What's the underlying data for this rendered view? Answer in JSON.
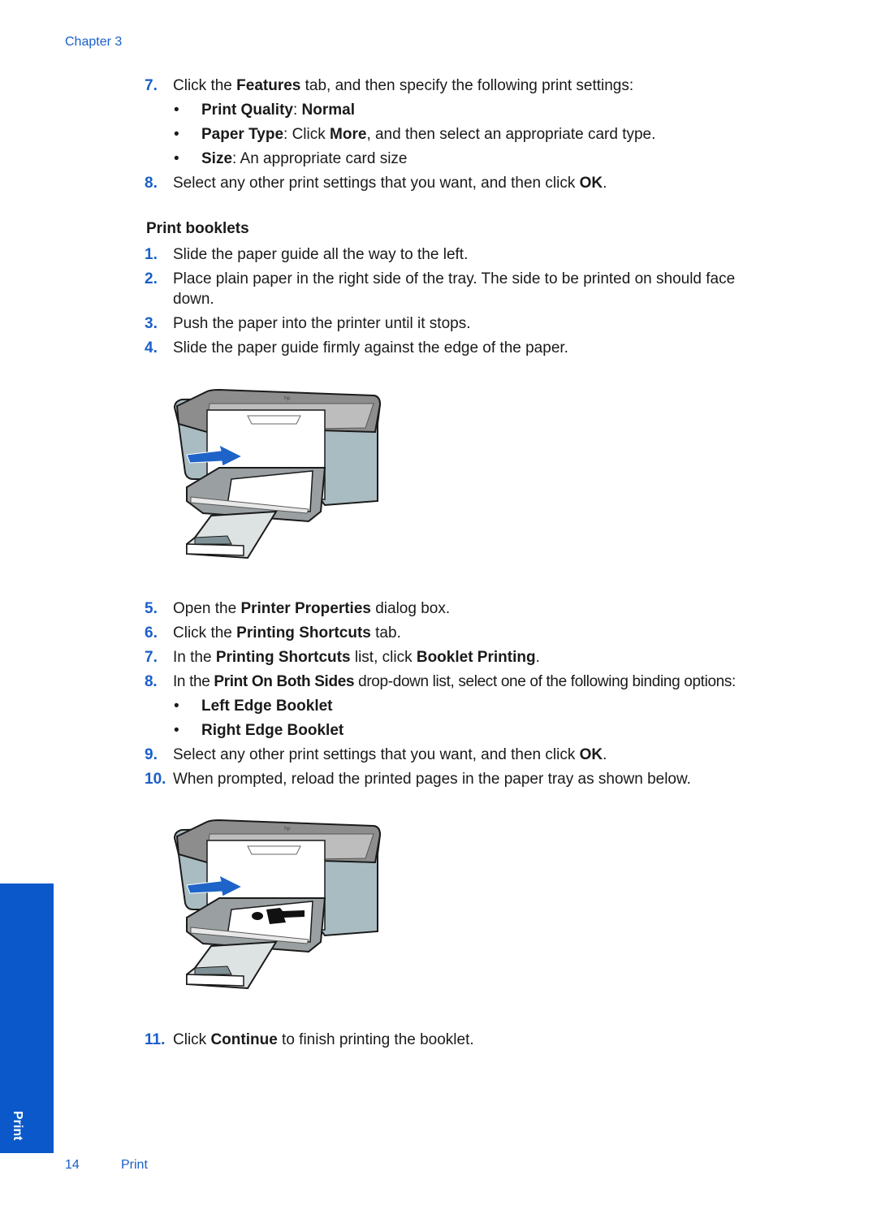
{
  "header": {
    "chapter": "Chapter 3"
  },
  "section_top": {
    "step7": {
      "num": "7.",
      "pre": "Click the ",
      "b1": "Features",
      "post": " tab, and then specify the following print settings:"
    },
    "bullets": [
      {
        "b1": "Print Quality",
        "mid": ": ",
        "b2": "Normal",
        "post": ""
      },
      {
        "b1": "Paper Type",
        "mid": ": Click ",
        "b2": "More",
        "post": ", and then select an appropriate card type."
      },
      {
        "b1": "Size",
        "mid": ": An appropriate card size",
        "b2": "",
        "post": ""
      }
    ],
    "step8": {
      "num": "8.",
      "pre": "Select any other print settings that you want, and then click ",
      "b1": "OK",
      "post": "."
    }
  },
  "booklets": {
    "heading": "Print booklets",
    "steps": [
      {
        "num": "1.",
        "text": "Slide the paper guide all the way to the left."
      },
      {
        "num": "2.",
        "text": "Place plain paper in the right side of the tray. The side to be printed on should face",
        "text2": "down."
      },
      {
        "num": "3.",
        "text": "Push the paper into the printer until it stops."
      },
      {
        "num": "4.",
        "text": "Slide the paper guide firmly against the edge of the paper."
      }
    ],
    "figure1": {
      "alt": "printer-loading-plain-paper"
    },
    "step5": {
      "num": "5.",
      "pre": "Open the ",
      "b1": "Printer Properties",
      "post": " dialog box."
    },
    "step6": {
      "num": "6.",
      "pre": "Click the ",
      "b1": "Printing Shortcuts",
      "post": " tab."
    },
    "step7": {
      "num": "7.",
      "pre": "In the ",
      "b1": "Printing Shortcuts",
      "mid": " list, click ",
      "b2": "Booklet Printing",
      "post": "."
    },
    "step8": {
      "num": "8.",
      "pre": "In the ",
      "b1": "Print On Both Sides",
      "post": " drop-down list, select one of the following binding options:"
    },
    "binding_options": [
      "Left Edge Booklet",
      "Right Edge Booklet"
    ],
    "step9": {
      "num": "9.",
      "pre": "Select any other print settings that you want, and then click ",
      "b1": "OK",
      "post": "."
    },
    "step10": {
      "num": "10.",
      "text": "When prompted, reload the printed pages in the paper tray as shown below."
    },
    "figure2": {
      "alt": "printer-reloading-printed-pages"
    },
    "step11": {
      "num": "11.",
      "pre": "Click ",
      "b1": "Continue",
      "post": " to finish printing the booklet."
    }
  },
  "sidetab": {
    "label": "Print",
    "color": "#0a58c9"
  },
  "footer": {
    "page": "14",
    "section": "Print"
  },
  "colors": {
    "accent": "#1a5fc8",
    "arrow": "#1e63c8",
    "printer_body": "#a9bcc2",
    "printer_top": "#8d8d8d"
  }
}
